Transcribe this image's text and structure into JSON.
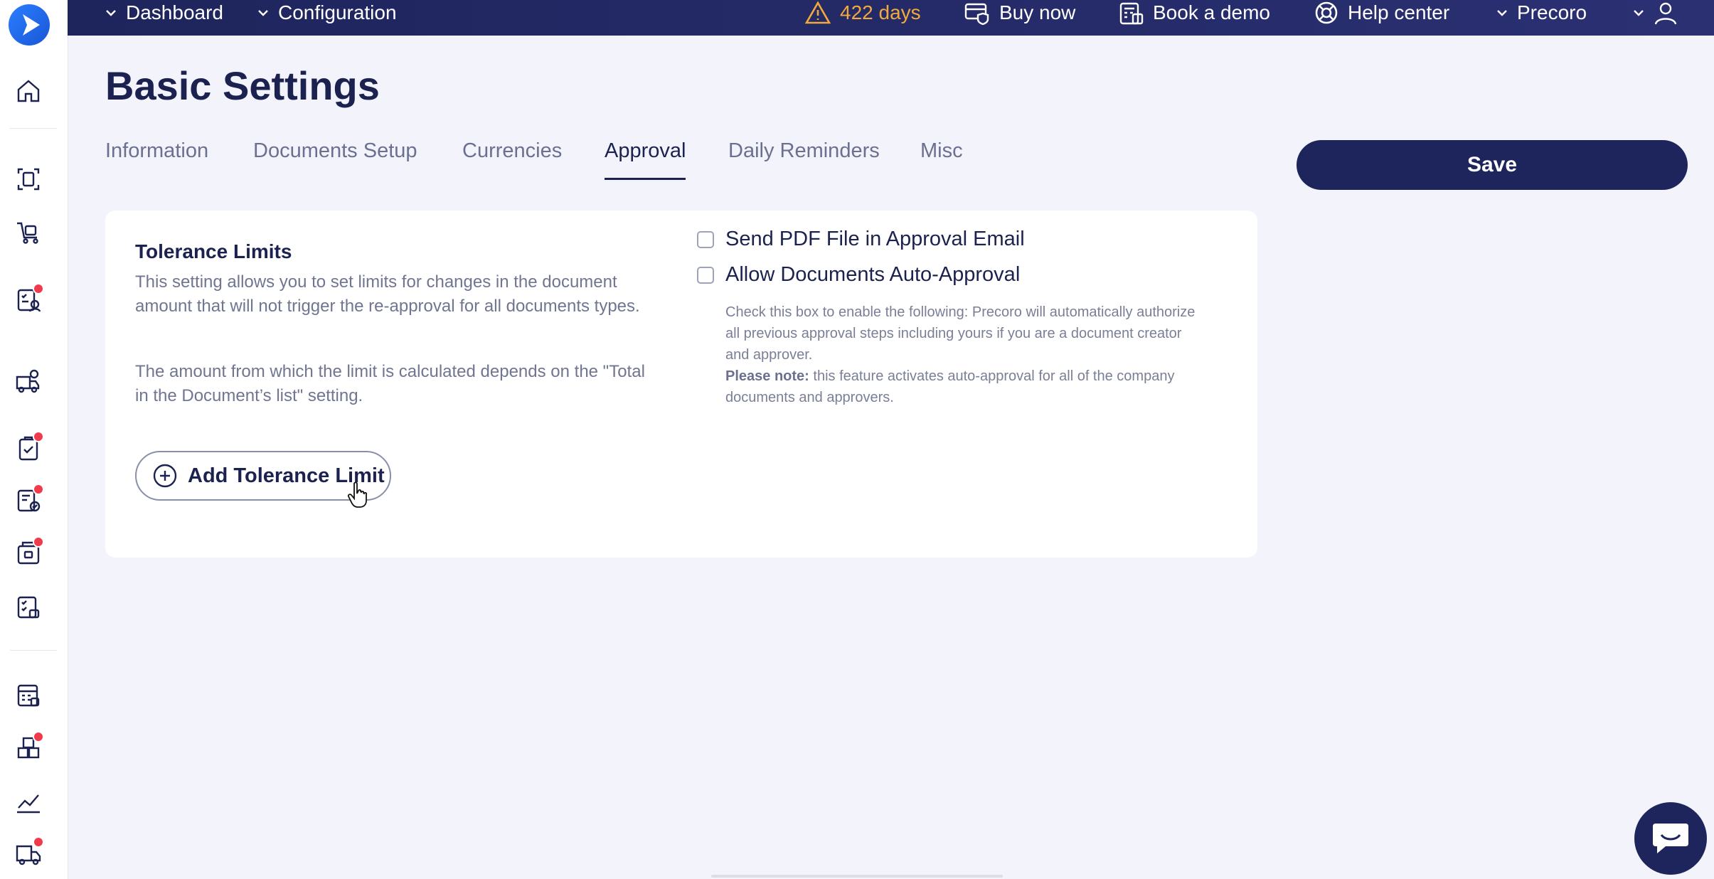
{
  "topbar": {
    "nav": [
      {
        "label": "Dashboard"
      },
      {
        "label": "Configuration"
      }
    ],
    "trial_days": "422 days",
    "buy_now": "Buy now",
    "book_demo": "Book a demo",
    "help_center": "Help center",
    "company": "Precoro"
  },
  "page": {
    "title": "Basic Settings",
    "save_label": "Save"
  },
  "tabs": [
    {
      "label": "Information",
      "active": false
    },
    {
      "label": "Documents Setup",
      "active": false
    },
    {
      "label": "Currencies",
      "active": false
    },
    {
      "label": "Approval",
      "active": true
    },
    {
      "label": "Daily Reminders",
      "active": false
    },
    {
      "label": "Misc",
      "active": false
    }
  ],
  "tolerance": {
    "title": "Tolerance Limits",
    "desc1": "This setting allows you to set limits for changes in the document amount that will not trigger the re-approval for all documents types.",
    "desc2": "The amount from which the limit is calculated depends on the \"Total in the Document’s list\" setting.",
    "add_label": "Add Tolerance Limit"
  },
  "options": {
    "send_pdf": {
      "label": "Send PDF File in Approval Email",
      "checked": false
    },
    "auto_approval": {
      "label": "Allow Documents Auto-Approval",
      "checked": false,
      "note": "Check this box to enable the following: Precoro will automatically authorize all previous approval steps including yours if you are a document creator and approver.",
      "please_note_label": "Please note:",
      "please_note_text": " this feature activates auto-approval for all of the company documents and approvers."
    }
  },
  "colors": {
    "brand_navy": "#1e255c",
    "warning": "#f2a93b",
    "notification": "#ef3b4c"
  }
}
